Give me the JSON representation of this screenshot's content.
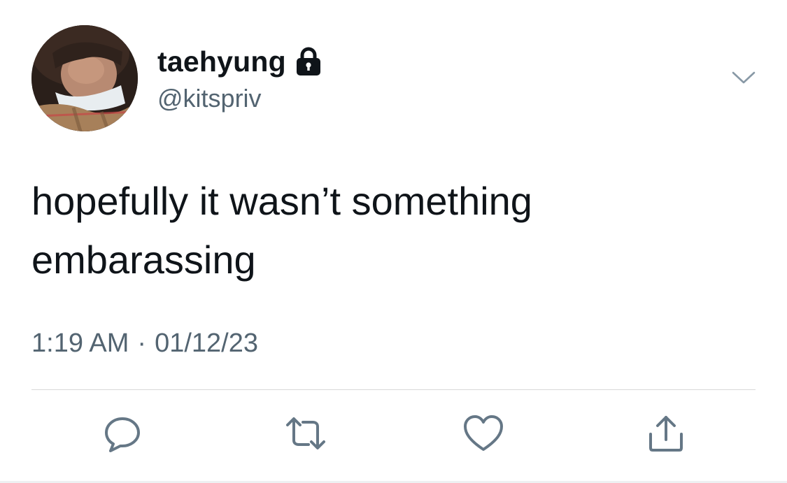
{
  "user": {
    "display_name": "taehyung",
    "handle": "@kitspriv",
    "protected_icon": "lock-icon",
    "avatar_icon": "avatar"
  },
  "tweet": {
    "text_line1": "hopefully it wasn’t something",
    "text_line2": "embarassing",
    "time": "1:19 AM",
    "separator": "·",
    "date": "01/12/23"
  },
  "actions": [
    {
      "icon": "reply-icon"
    },
    {
      "icon": "retweet-icon"
    },
    {
      "icon": "like-icon"
    },
    {
      "icon": "share-icon"
    }
  ],
  "menu": {
    "icon": "chevron-down-icon"
  },
  "colors": {
    "text_primary": "#0f1419",
    "text_secondary": "#536471",
    "divider": "#d9d9d9"
  }
}
